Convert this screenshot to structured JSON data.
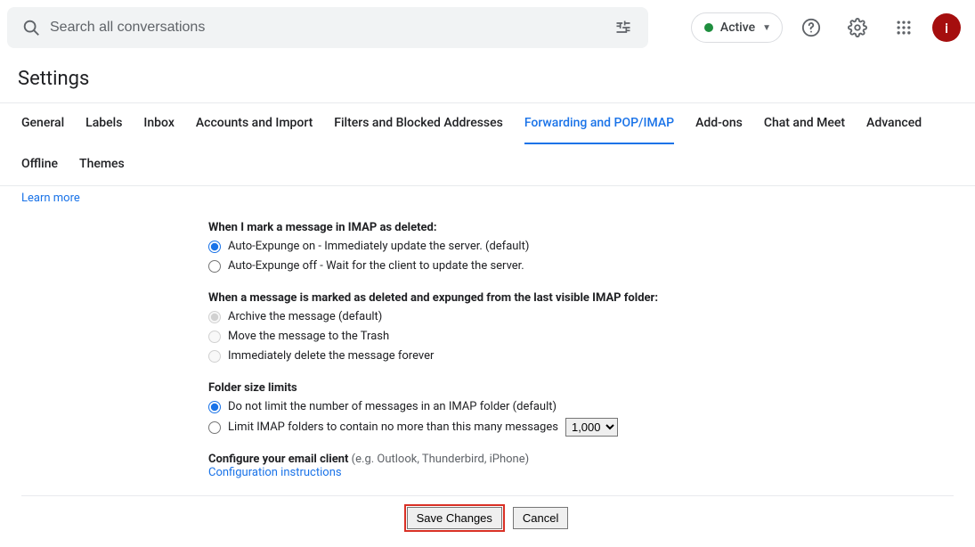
{
  "search": {
    "placeholder": "Search all conversations"
  },
  "status": {
    "label": "Active"
  },
  "avatar_letter": "i",
  "page_title": "Settings",
  "tabs": [
    "General",
    "Labels",
    "Inbox",
    "Accounts and Import",
    "Filters and Blocked Addresses",
    "Forwarding and POP/IMAP",
    "Add-ons",
    "Chat and Meet",
    "Advanced",
    "Offline",
    "Themes"
  ],
  "active_tab": "Forwarding and POP/IMAP",
  "learn_more": "Learn more",
  "imap_delete": {
    "heading": "When I mark a message in IMAP as deleted:",
    "options": [
      "Auto-Expunge on - Immediately update the server. (default)",
      "Auto-Expunge off - Wait for the client to update the server."
    ]
  },
  "expunged": {
    "heading": "When a message is marked as deleted and expunged from the last visible IMAP folder:",
    "options": [
      "Archive the message (default)",
      "Move the message to the Trash",
      "Immediately delete the message forever"
    ]
  },
  "folder_limits": {
    "heading": "Folder size limits",
    "options": [
      "Do not limit the number of messages in an IMAP folder (default)",
      "Limit IMAP folders to contain no more than this many messages"
    ],
    "select_value": "1,000"
  },
  "configure": {
    "heading": "Configure your email client",
    "hint": "(e.g. Outlook, Thunderbird, iPhone)",
    "link": "Configuration instructions"
  },
  "buttons": {
    "save": "Save Changes",
    "cancel": "Cancel"
  }
}
